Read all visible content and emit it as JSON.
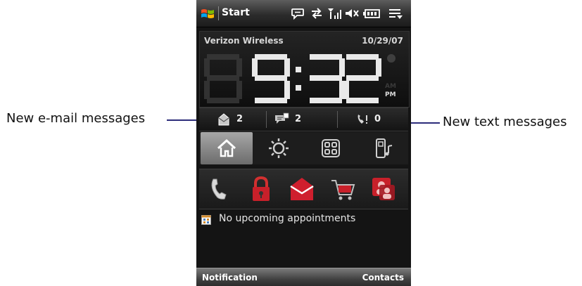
{
  "callouts": {
    "left": "New e-mail messages",
    "right": "New text messages"
  },
  "titlebar": {
    "start_label": "Start",
    "icons": [
      "windows-logo-icon",
      "chat-bubble-icon",
      "sync-arrows-icon",
      "signal-strength-icon",
      "speaker-muted-icon",
      "battery-icon",
      "menu-icon"
    ]
  },
  "home": {
    "carrier": "Verizon Wireless",
    "date": "10/29/07",
    "clock": {
      "hour_dim": "8",
      "hour": "9",
      "separator": ":",
      "minute": "32",
      "am": "AM",
      "pm": "PM",
      "active_period": "PM"
    },
    "counts": {
      "email": "2",
      "text": "2",
      "calls": "0"
    }
  },
  "tabs": [
    {
      "icon": "home-icon",
      "active": true
    },
    {
      "icon": "weather-sun-icon",
      "active": false
    },
    {
      "icon": "apps-grid-icon",
      "active": false
    },
    {
      "icon": "phone-music-icon",
      "active": false
    }
  ],
  "apps": [
    "phone-handset-icon",
    "lock-icon",
    "mail-icon",
    "shopping-cart-icon",
    "contacts-icon"
  ],
  "appointments": {
    "text": "No upcoming appointments",
    "icon": "calendar-icon"
  },
  "softkeys": {
    "left": "Notification",
    "right": "Contacts"
  },
  "colors": {
    "callout_line": "#2c2c7a",
    "tab_active": "#a7a7a7",
    "screen_bg": "#141414"
  }
}
